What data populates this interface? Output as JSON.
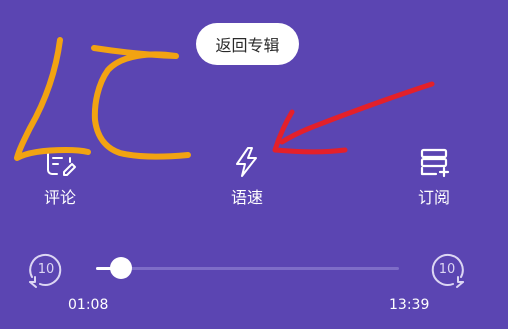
{
  "header": {
    "back_to_album_label": "返回专辑"
  },
  "actions": {
    "comment_label": "评论",
    "speed_label": "语速",
    "subscribe_label": "订阅"
  },
  "player": {
    "skip_back_seconds": "10",
    "skip_forward_seconds": "10",
    "current_time": "01:08",
    "total_time": "13:39",
    "progress_fraction": 0.083
  },
  "colors": {
    "background": "#5b45b2",
    "annotation_orange": "#f2a312",
    "annotation_red": "#e4202a"
  },
  "icons": {
    "comment": "edit-note-icon",
    "speed": "lightning-bolt-icon",
    "subscribe": "playlist-add-icon",
    "skip_back": "rewind-10-icon",
    "skip_forward": "forward-10-icon"
  }
}
